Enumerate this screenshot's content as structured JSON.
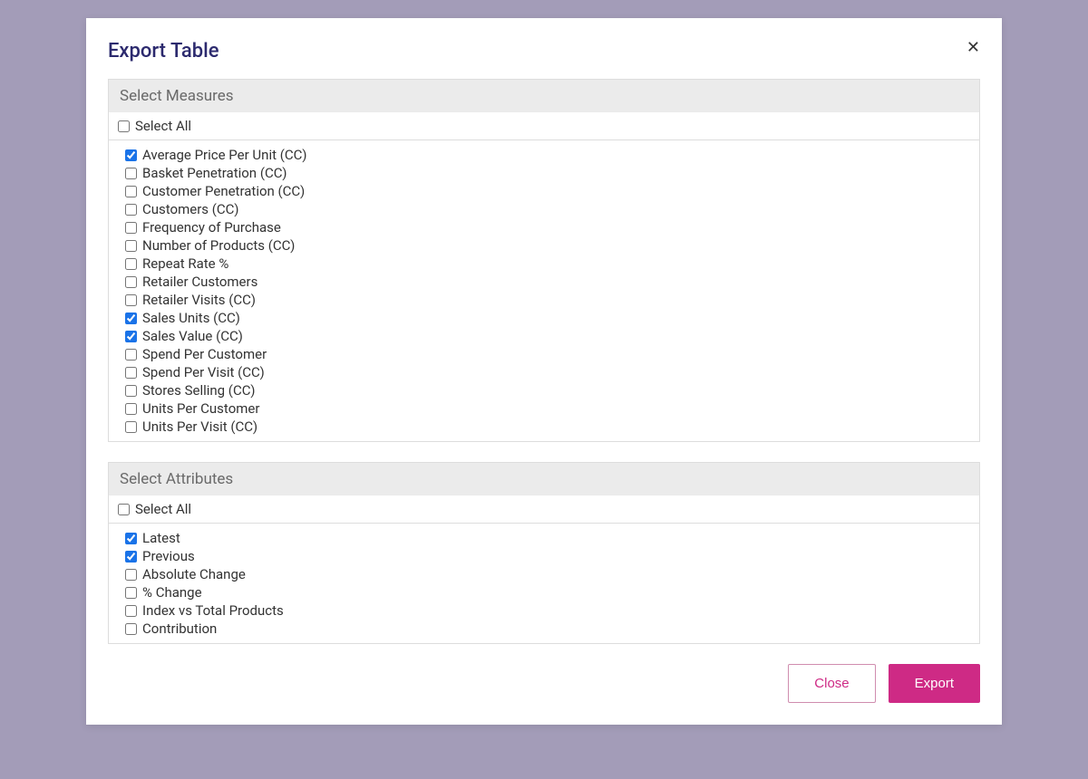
{
  "modal": {
    "title": "Export Table"
  },
  "sections": {
    "measures": {
      "header": "Select Measures",
      "select_all": "Select All",
      "items": [
        {
          "label": "Average Price Per Unit (CC)",
          "checked": true
        },
        {
          "label": "Basket Penetration (CC)",
          "checked": false
        },
        {
          "label": "Customer Penetration (CC)",
          "checked": false
        },
        {
          "label": "Customers (CC)",
          "checked": false
        },
        {
          "label": "Frequency of Purchase",
          "checked": false
        },
        {
          "label": "Number of Products (CC)",
          "checked": false
        },
        {
          "label": "Repeat Rate %",
          "checked": false
        },
        {
          "label": "Retailer Customers",
          "checked": false
        },
        {
          "label": "Retailer Visits (CC)",
          "checked": false
        },
        {
          "label": "Sales Units (CC)",
          "checked": true
        },
        {
          "label": "Sales Value (CC)",
          "checked": true
        },
        {
          "label": "Spend Per Customer",
          "checked": false
        },
        {
          "label": "Spend Per Visit (CC)",
          "checked": false
        },
        {
          "label": "Stores Selling (CC)",
          "checked": false
        },
        {
          "label": "Units Per Customer",
          "checked": false
        },
        {
          "label": "Units Per Visit (CC)",
          "checked": false
        }
      ]
    },
    "attributes": {
      "header": "Select Attributes",
      "select_all": "Select All",
      "items": [
        {
          "label": "Latest",
          "checked": true
        },
        {
          "label": "Previous",
          "checked": true
        },
        {
          "label": "Absolute Change",
          "checked": false
        },
        {
          "label": "% Change",
          "checked": false
        },
        {
          "label": "Index vs Total Products",
          "checked": false
        },
        {
          "label": "Contribution",
          "checked": false
        }
      ]
    }
  },
  "buttons": {
    "close": "Close",
    "export": "Export"
  }
}
